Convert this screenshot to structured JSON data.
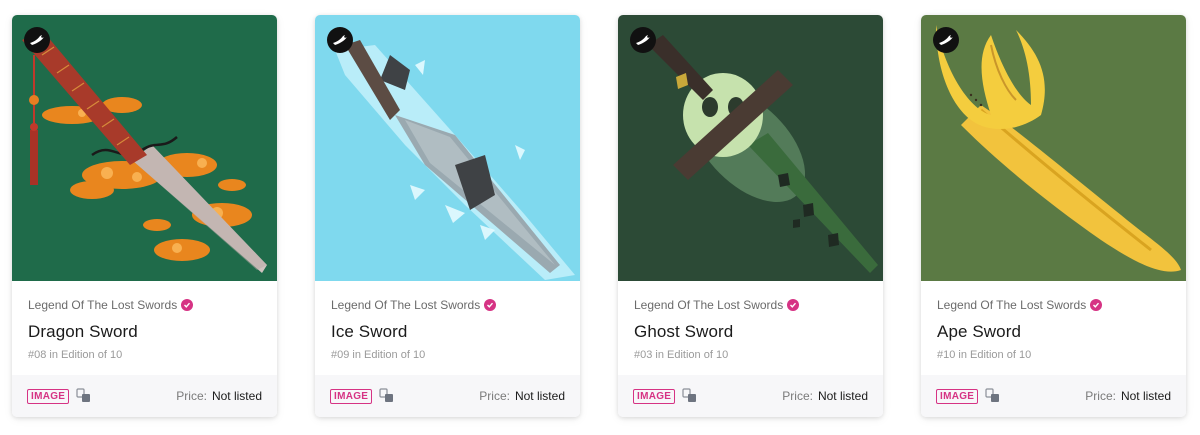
{
  "cards": [
    {
      "collection": "Legend Of The Lost Swords",
      "title": "Dragon Sword",
      "edition": "#08 in Edition of 10",
      "tag": "IMAGE",
      "price_label": "Price:",
      "price_value": "Not listed",
      "bg": "#1f6b4a"
    },
    {
      "collection": "Legend Of The Lost Swords",
      "title": "Ice Sword",
      "edition": "#09 in Edition of 10",
      "tag": "IMAGE",
      "price_label": "Price:",
      "price_value": "Not listed",
      "bg": "#7fd9ee"
    },
    {
      "collection": "Legend Of The Lost Swords",
      "title": "Ghost Sword",
      "edition": "#03 in Edition of 10",
      "tag": "IMAGE",
      "price_label": "Price:",
      "price_value": "Not listed",
      "bg": "#2c4a36"
    },
    {
      "collection": "Legend Of The Lost Swords",
      "title": "Ape Sword",
      "edition": "#10 in Edition of 10",
      "tag": "IMAGE",
      "price_label": "Price:",
      "price_value": "Not listed",
      "bg": "#5b7a44"
    }
  ],
  "icons": {
    "top_badge": "creator-bird-icon",
    "verified": "verified-check-icon",
    "media": "media-type-icon"
  },
  "colors": {
    "accent": "#d63384",
    "footer_bg": "#f7f7f9"
  }
}
